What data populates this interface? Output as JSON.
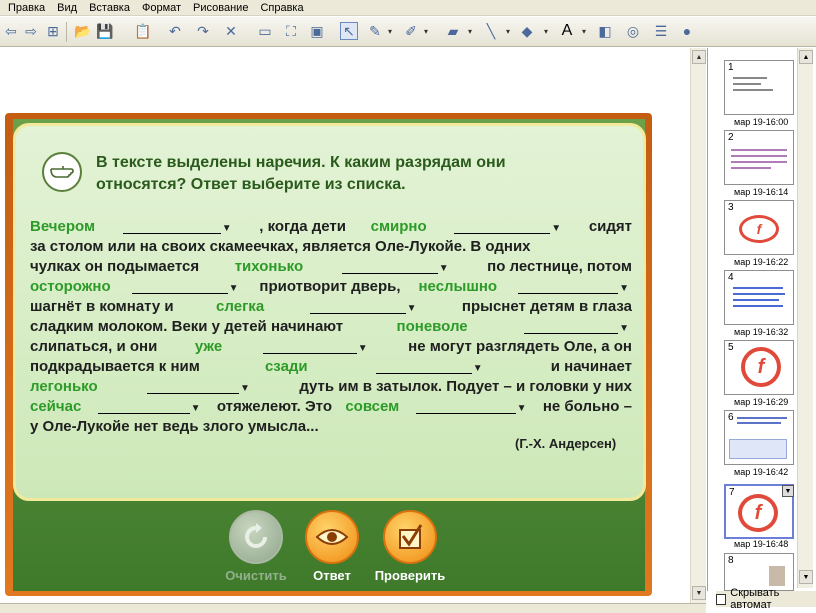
{
  "menu": [
    "Правка",
    "Вид",
    "Вставка",
    "Формат",
    "Рисование",
    "Справка"
  ],
  "slide": {
    "question": "В тексте выделены наречия. К каким разрядам они относятся? Ответ выберите из списка.",
    "lines": [
      [
        "Вечером",
        "@",
        ", когда дети",
        "смирно",
        "@",
        "сидят"
      ],
      [
        "за столом или на своих скамеечках, является Оле-Лукойе. В одних"
      ],
      [
        "чулках он подымается",
        "тихонько",
        "@",
        "по лестнице, потом"
      ],
      [
        "осторожно",
        "@",
        "приотворит дверь,",
        "неслышно",
        "@"
      ],
      [
        "шагнёт в комнату и",
        "слегка",
        "@",
        "прыснет детям в глаза"
      ],
      [
        "сладким молоком. Веки у детей начинают",
        "поневоле",
        "@"
      ],
      [
        "слипаться, и они",
        "уже",
        "@",
        "не могут разглядеть Оле, а он"
      ],
      [
        "подкрадывается к ним",
        "сзади",
        "@",
        "и начинает"
      ],
      [
        "легонько",
        "@",
        "дуть им в затылок. Подует – и головки у них"
      ],
      [
        "сейчас",
        "@",
        "отяжелеют. Это",
        "совсем",
        "@",
        "не больно –"
      ],
      [
        "у Оле-Лукойе нет ведь злого умысла..."
      ]
    ],
    "adverbs": [
      "Вечером",
      "смирно",
      "тихонько",
      "осторожно",
      "неслышно",
      "слегка",
      "поневоле",
      "уже",
      "сзади",
      "легонько",
      "сейчас",
      "совсем"
    ],
    "author": "(Г.-Х.  Андерсен)",
    "buttons": {
      "clear": "Очистить",
      "answer": "Ответ",
      "check": "Проверить"
    }
  },
  "thumbnails": [
    {
      "num": "1",
      "date": "мар 19-16:00"
    },
    {
      "num": "2",
      "date": "мар 19-16:14"
    },
    {
      "num": "3",
      "date": "мар 19-16:22"
    },
    {
      "num": "4",
      "date": "мар 19-16:32"
    },
    {
      "num": "5",
      "date": "мар 19-16:29"
    },
    {
      "num": "6",
      "date": "мар 19-16:42"
    },
    {
      "num": "7",
      "date": "мар 19-16:48"
    },
    {
      "num": "8",
      "date": ""
    }
  ],
  "autohide_label": "Скрывать автомат",
  "colors": {
    "adverb": "#2d9b28",
    "title": "#2a5b1c",
    "frame": "#c45d12",
    "card": "#dff0d1"
  }
}
